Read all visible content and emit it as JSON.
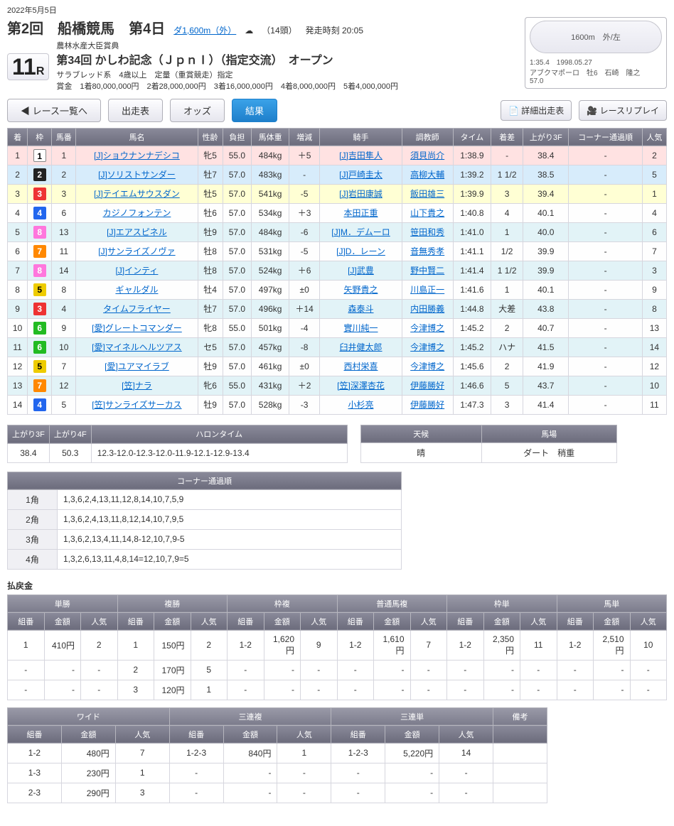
{
  "date": "2022年5月5日",
  "meeting": "第2回　船橋競馬　第4日",
  "course": "ダ1,600m（外）",
  "weather_icon": "☁",
  "heads": "（14頭）",
  "start_time": "発走時刻 20:05",
  "race_number": "11",
  "race_r": "R",
  "subtitle": "農林水産大臣賞典",
  "race_name": "第34回 かしわ記念（ＪｐｎⅠ）（指定交流）　オープン",
  "race_cond": "サラブレッド系　4歳以上　定量（重賞競走）指定",
  "prize": "賞金　1着80,000,000円　2着28,000,000円　3着16,000,000円　4着8,000,000円　5着4,000,000円",
  "record": {
    "track_label": "1600m　外/左",
    "time": "1:35.4　1998.05.27",
    "horse": "アブクマポーロ　牡6　石崎　隆之",
    "weight": "57.0"
  },
  "buttons": {
    "back": "レース一覧へ",
    "entries": "出走表",
    "odds": "オッズ",
    "result": "結果",
    "detail": "詳細出走表",
    "replay": "レースリプレイ"
  },
  "headers": {
    "rank": "着",
    "waku": "枠",
    "num": "馬番",
    "name": "馬名",
    "sexage": "性齢",
    "wt": "負担",
    "bwt": "馬体重",
    "diff": "増減",
    "jockey": "騎手",
    "trainer": "調教師",
    "time": "タイム",
    "margin": "着差",
    "last3f": "上がり3F",
    "corners": "コーナー通過順",
    "pop": "人気"
  },
  "rows": [
    {
      "rank": "1",
      "waku": "1",
      "wakuCls": "w1",
      "num": "1",
      "name": "[J]ショウナンナデシコ",
      "sexage": "牝5",
      "wt": "55.0",
      "bwt": "484kg",
      "diff": "＋5",
      "jockey": "[J]吉田隼人",
      "trainer": "須貝尚介",
      "time": "1:38.9",
      "margin": "-",
      "last3f": "38.4",
      "corners": "-",
      "pop": "2",
      "rowCls": "r1"
    },
    {
      "rank": "2",
      "waku": "2",
      "wakuCls": "w2",
      "num": "2",
      "name": "[J]ソリストサンダー",
      "sexage": "牡7",
      "wt": "57.0",
      "bwt": "483kg",
      "diff": "-",
      "jockey": "[J]戸崎圭太",
      "trainer": "高柳大輔",
      "time": "1:39.2",
      "margin": "1 1/2",
      "last3f": "38.5",
      "corners": "-",
      "pop": "5",
      "rowCls": "r2"
    },
    {
      "rank": "3",
      "waku": "3",
      "wakuCls": "w3",
      "num": "3",
      "name": "[J]テイエムサウスダン",
      "sexage": "牡5",
      "wt": "57.0",
      "bwt": "541kg",
      "diff": "-5",
      "jockey": "[J]岩田康誠",
      "trainer": "飯田雄三",
      "time": "1:39.9",
      "margin": "3",
      "last3f": "39.4",
      "corners": "-",
      "pop": "1",
      "rowCls": "r3"
    },
    {
      "rank": "4",
      "waku": "4",
      "wakuCls": "w4",
      "num": "6",
      "name": "カジノフォンテン",
      "sexage": "牡6",
      "wt": "57.0",
      "bwt": "534kg",
      "diff": "＋3",
      "jockey": "本田正重",
      "trainer": "山下貴之",
      "time": "1:40.8",
      "margin": "4",
      "last3f": "40.1",
      "corners": "-",
      "pop": "4",
      "rowCls": "r4"
    },
    {
      "rank": "5",
      "waku": "8",
      "wakuCls": "w8",
      "num": "13",
      "name": "[J]エアスピネル",
      "sexage": "牡9",
      "wt": "57.0",
      "bwt": "484kg",
      "diff": "-6",
      "jockey": "[J]M．デムーロ",
      "trainer": "笹田和秀",
      "time": "1:41.0",
      "margin": "1",
      "last3f": "40.0",
      "corners": "-",
      "pop": "6",
      "rowCls": "rE"
    },
    {
      "rank": "6",
      "waku": "7",
      "wakuCls": "w7",
      "num": "11",
      "name": "[J]サンライズノヴァ",
      "sexage": "牡8",
      "wt": "57.0",
      "bwt": "531kg",
      "diff": "-5",
      "jockey": "[J]D．レーン",
      "trainer": "音無秀孝",
      "time": "1:41.1",
      "margin": "1/2",
      "last3f": "39.9",
      "corners": "-",
      "pop": "7",
      "rowCls": "r4"
    },
    {
      "rank": "7",
      "waku": "8",
      "wakuCls": "w8",
      "num": "14",
      "name": "[J]インティ",
      "sexage": "牡8",
      "wt": "57.0",
      "bwt": "524kg",
      "diff": "＋6",
      "jockey": "[J]武豊",
      "trainer": "野中賢二",
      "time": "1:41.4",
      "margin": "1 1/2",
      "last3f": "39.9",
      "corners": "-",
      "pop": "3",
      "rowCls": "rE"
    },
    {
      "rank": "8",
      "waku": "5",
      "wakuCls": "w5",
      "num": "8",
      "name": "ギャルダル",
      "sexage": "牡4",
      "wt": "57.0",
      "bwt": "497kg",
      "diff": "±0",
      "jockey": "矢野貴之",
      "trainer": "川島正一",
      "time": "1:41.6",
      "margin": "1",
      "last3f": "40.1",
      "corners": "-",
      "pop": "9",
      "rowCls": "r4"
    },
    {
      "rank": "9",
      "waku": "3",
      "wakuCls": "w3",
      "num": "4",
      "name": "タイムフライヤー",
      "sexage": "牡7",
      "wt": "57.0",
      "bwt": "496kg",
      "diff": "＋14",
      "jockey": "森泰斗",
      "trainer": "内田勝義",
      "time": "1:44.8",
      "margin": "大差",
      "last3f": "43.8",
      "corners": "-",
      "pop": "8",
      "rowCls": "rE"
    },
    {
      "rank": "10",
      "waku": "6",
      "wakuCls": "w6",
      "num": "9",
      "name": "[愛]グレートコマンダー",
      "sexage": "牝8",
      "wt": "55.0",
      "bwt": "501kg",
      "diff": "-4",
      "jockey": "實川純一",
      "trainer": "今津博之",
      "time": "1:45.2",
      "margin": "2",
      "last3f": "40.7",
      "corners": "-",
      "pop": "13",
      "rowCls": "r4"
    },
    {
      "rank": "11",
      "waku": "6",
      "wakuCls": "w6",
      "num": "10",
      "name": "[愛]マイネルヘルツアス",
      "sexage": "セ5",
      "wt": "57.0",
      "bwt": "457kg",
      "diff": "-8",
      "jockey": "臼井健太郎",
      "trainer": "今津博之",
      "time": "1:45.2",
      "margin": "ハナ",
      "last3f": "41.5",
      "corners": "-",
      "pop": "14",
      "rowCls": "rE"
    },
    {
      "rank": "12",
      "waku": "5",
      "wakuCls": "w5",
      "num": "7",
      "name": "[愛]ユアマイラブ",
      "sexage": "牡9",
      "wt": "57.0",
      "bwt": "461kg",
      "diff": "±0",
      "jockey": "西村栄喜",
      "trainer": "今津博之",
      "time": "1:45.6",
      "margin": "2",
      "last3f": "41.9",
      "corners": "-",
      "pop": "12",
      "rowCls": "r4"
    },
    {
      "rank": "13",
      "waku": "7",
      "wakuCls": "w7",
      "num": "12",
      "name": "[笠]ナラ",
      "sexage": "牝6",
      "wt": "55.0",
      "bwt": "431kg",
      "diff": "＋2",
      "jockey": "[笠]深澤杏花",
      "trainer": "伊藤勝好",
      "time": "1:46.6",
      "margin": "5",
      "last3f": "43.7",
      "corners": "-",
      "pop": "10",
      "rowCls": "rE"
    },
    {
      "rank": "14",
      "waku": "4",
      "wakuCls": "w4",
      "num": "5",
      "name": "[笠]サンライズサーカス",
      "sexage": "牡9",
      "wt": "57.0",
      "bwt": "528kg",
      "diff": "-3",
      "jockey": "小杉亮",
      "trainer": "伊藤勝好",
      "time": "1:47.3",
      "margin": "3",
      "last3f": "41.4",
      "corners": "-",
      "pop": "11",
      "rowCls": "r4"
    }
  ],
  "lap": {
    "h_last3f": "上がり3F",
    "h_last4f": "上がり4F",
    "h_halon": "ハロンタイム",
    "last3f": "38.4",
    "last4f": "50.3",
    "halon": "12.3-12.0-12.3-12.0-11.9-12.1-12.9-13.4",
    "h_weather": "天候",
    "h_track": "馬場",
    "weather": "晴",
    "track": "ダート　稍重"
  },
  "corner": {
    "title": "コーナー通過順",
    "labels": [
      "1角",
      "2角",
      "3角",
      "4角"
    ],
    "orders": [
      "1,3,6,2,4,13,11,12,8,14,10,7,5,9",
      "1,3,6,2,4,13,11,8,12,14,10,7,9,5",
      "1,3,6,2,13,4,11,14,8-12,10,7,9-5",
      "1,3,2,6,13,11,4,8,14=12,10,7,9=5"
    ]
  },
  "payouts_title": "払戻金",
  "pay_h": {
    "kumi": "組番",
    "amt": "金額",
    "pop": "人気"
  },
  "pay_cats1": [
    "単勝",
    "複勝",
    "枠複",
    "普通馬複",
    "枠単",
    "馬単"
  ],
  "pay_cats2": [
    "ワイド",
    "三連複",
    "三連単",
    "備考"
  ],
  "pay1": [
    [
      {
        "k": "1",
        "a": "410円",
        "p": "2"
      },
      {
        "k": "1",
        "a": "150円",
        "p": "2"
      },
      {
        "k": "1-2",
        "a": "1,620円",
        "p": "9"
      },
      {
        "k": "1-2",
        "a": "1,610円",
        "p": "7"
      },
      {
        "k": "1-2",
        "a": "2,350円",
        "p": "11"
      },
      {
        "k": "1-2",
        "a": "2,510円",
        "p": "10"
      }
    ],
    [
      {
        "k": "-",
        "a": "-",
        "p": "-"
      },
      {
        "k": "2",
        "a": "170円",
        "p": "5"
      },
      {
        "k": "-",
        "a": "-",
        "p": "-"
      },
      {
        "k": "-",
        "a": "-",
        "p": "-"
      },
      {
        "k": "-",
        "a": "-",
        "p": "-"
      },
      {
        "k": "-",
        "a": "-",
        "p": "-"
      }
    ],
    [
      {
        "k": "-",
        "a": "-",
        "p": "-"
      },
      {
        "k": "3",
        "a": "120円",
        "p": "1"
      },
      {
        "k": "-",
        "a": "-",
        "p": "-"
      },
      {
        "k": "-",
        "a": "-",
        "p": "-"
      },
      {
        "k": "-",
        "a": "-",
        "p": "-"
      },
      {
        "k": "-",
        "a": "-",
        "p": "-"
      }
    ]
  ],
  "pay2": [
    [
      {
        "k": "1-2",
        "a": "480円",
        "p": "7"
      },
      {
        "k": "1-2-3",
        "a": "840円",
        "p": "1"
      },
      {
        "k": "1-2-3",
        "a": "5,220円",
        "p": "14"
      },
      {
        "k": "",
        "a": "",
        "p": ""
      }
    ],
    [
      {
        "k": "1-3",
        "a": "230円",
        "p": "1"
      },
      {
        "k": "-",
        "a": "-",
        "p": "-"
      },
      {
        "k": "-",
        "a": "-",
        "p": "-"
      },
      {
        "k": "",
        "a": "",
        "p": ""
      }
    ],
    [
      {
        "k": "2-3",
        "a": "290円",
        "p": "3"
      },
      {
        "k": "-",
        "a": "-",
        "p": "-"
      },
      {
        "k": "-",
        "a": "-",
        "p": "-"
      },
      {
        "k": "",
        "a": "",
        "p": ""
      }
    ]
  ]
}
